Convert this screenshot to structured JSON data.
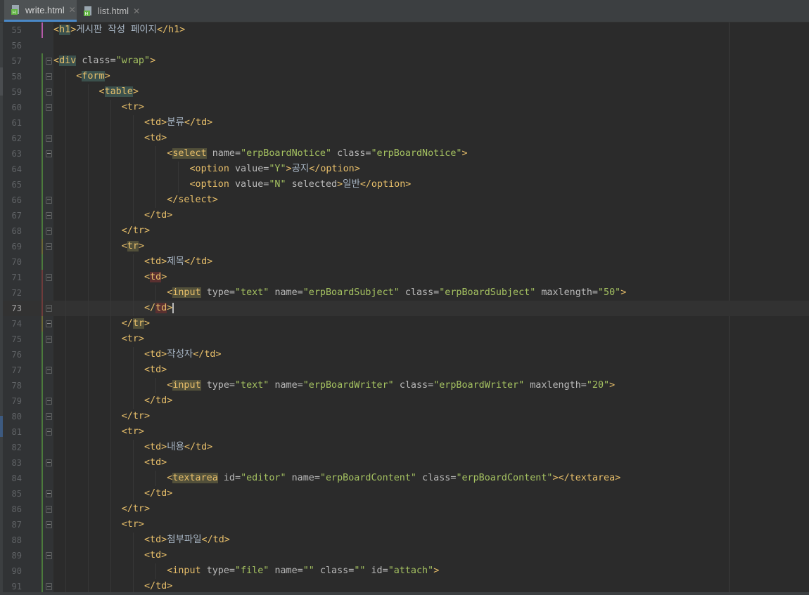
{
  "tabs": [
    {
      "label": "write.html",
      "active": true
    },
    {
      "label": "list.html",
      "active": false
    }
  ],
  "colors": {
    "tag": "#e8bf6a",
    "attribute": "#bababa",
    "value": "#a5c261",
    "text": "#a9b7c6",
    "line_number": "#606366"
  },
  "current_line": 73,
  "lines": [
    {
      "n": 55,
      "indent": 0,
      "tokens": [
        [
          "t",
          "<h1>"
        ],
        [
          "x",
          "게시판 작성 페이지"
        ],
        [
          "t",
          "</h1>"
        ]
      ]
    },
    {
      "n": 56,
      "indent": 0,
      "tokens": []
    },
    {
      "n": 57,
      "indent": 0,
      "fold": true,
      "tokens": [
        [
          "t",
          "<div "
        ],
        [
          "a",
          "class="
        ],
        [
          "v",
          "\"wrap\""
        ],
        [
          "t",
          ">"
        ]
      ]
    },
    {
      "n": 58,
      "indent": 1,
      "fold": true,
      "tokens": [
        [
          "t",
          "<form>"
        ]
      ]
    },
    {
      "n": 59,
      "indent": 2,
      "fold": true,
      "tokens": [
        [
          "t",
          "<table>"
        ]
      ]
    },
    {
      "n": 60,
      "indent": 3,
      "fold": true,
      "tokens": [
        [
          "t",
          "<tr>"
        ]
      ]
    },
    {
      "n": 61,
      "indent": 4,
      "tokens": [
        [
          "t",
          "<td>"
        ],
        [
          "x",
          "분류"
        ],
        [
          "t",
          "</td>"
        ]
      ]
    },
    {
      "n": 62,
      "indent": 4,
      "fold": true,
      "tokens": [
        [
          "t",
          "<td>"
        ]
      ]
    },
    {
      "n": 63,
      "indent": 5,
      "fold": true,
      "tokens": [
        [
          "t",
          "<select "
        ],
        [
          "a",
          "name="
        ],
        [
          "v",
          "\"erpBoardNotice\" "
        ],
        [
          "a",
          "class="
        ],
        [
          "v",
          "\"erpBoardNotice\""
        ],
        [
          "t",
          ">"
        ]
      ]
    },
    {
      "n": 64,
      "indent": 6,
      "tokens": [
        [
          "t",
          "<option "
        ],
        [
          "a",
          "value="
        ],
        [
          "v",
          "\"Y\""
        ],
        [
          "t",
          ">"
        ],
        [
          "x",
          "공지"
        ],
        [
          "t",
          "</option>"
        ]
      ]
    },
    {
      "n": 65,
      "indent": 6,
      "tokens": [
        [
          "t",
          "<option "
        ],
        [
          "a",
          "value="
        ],
        [
          "v",
          "\"N\" "
        ],
        [
          "a",
          "selected"
        ],
        [
          "t",
          ">"
        ],
        [
          "x",
          "일반"
        ],
        [
          "t",
          "</option>"
        ]
      ]
    },
    {
      "n": 66,
      "indent": 5,
      "fold": true,
      "tokens": [
        [
          "t",
          "</select>"
        ]
      ]
    },
    {
      "n": 67,
      "indent": 4,
      "fold": true,
      "tokens": [
        [
          "t",
          "</td>"
        ]
      ]
    },
    {
      "n": 68,
      "indent": 3,
      "fold": true,
      "tokens": [
        [
          "t",
          "</tr>"
        ]
      ]
    },
    {
      "n": 69,
      "indent": 3,
      "fold": true,
      "tokens": [
        [
          "t",
          "<tr>"
        ]
      ]
    },
    {
      "n": 70,
      "indent": 4,
      "tokens": [
        [
          "t",
          "<td>"
        ],
        [
          "x",
          "제목"
        ],
        [
          "t",
          "</td>"
        ]
      ]
    },
    {
      "n": 71,
      "indent": 4,
      "fold": true,
      "tokens": [
        [
          "t",
          "<td>"
        ]
      ]
    },
    {
      "n": 72,
      "indent": 5,
      "tokens": [
        [
          "t",
          "<input "
        ],
        [
          "a",
          "type="
        ],
        [
          "v",
          "\"text\" "
        ],
        [
          "a",
          "name="
        ],
        [
          "v",
          "\"erpBoardSubject\" "
        ],
        [
          "a",
          "class="
        ],
        [
          "v",
          "\"erpBoardSubject\" "
        ],
        [
          "a",
          "maxlength="
        ],
        [
          "v",
          "\"50\""
        ],
        [
          "t",
          ">"
        ]
      ]
    },
    {
      "n": 73,
      "indent": 4,
      "fold": true,
      "tokens": [
        [
          "t",
          "</td>"
        ]
      ]
    },
    {
      "n": 74,
      "indent": 3,
      "fold": true,
      "tokens": [
        [
          "t",
          "</tr>"
        ]
      ]
    },
    {
      "n": 75,
      "indent": 3,
      "fold": true,
      "tokens": [
        [
          "t",
          "<tr>"
        ]
      ]
    },
    {
      "n": 76,
      "indent": 4,
      "tokens": [
        [
          "t",
          "<td>"
        ],
        [
          "x",
          "작성자"
        ],
        [
          "t",
          "</td>"
        ]
      ]
    },
    {
      "n": 77,
      "indent": 4,
      "fold": true,
      "tokens": [
        [
          "t",
          "<td>"
        ]
      ]
    },
    {
      "n": 78,
      "indent": 5,
      "tokens": [
        [
          "t",
          "<input "
        ],
        [
          "a",
          "type="
        ],
        [
          "v",
          "\"text\" "
        ],
        [
          "a",
          "name="
        ],
        [
          "v",
          "\"erpBoardWriter\" "
        ],
        [
          "a",
          "class="
        ],
        [
          "v",
          "\"erpBoardWriter\" "
        ],
        [
          "a",
          "maxlength="
        ],
        [
          "v",
          "\"20\""
        ],
        [
          "t",
          ">"
        ]
      ]
    },
    {
      "n": 79,
      "indent": 4,
      "fold": true,
      "tokens": [
        [
          "t",
          "</td>"
        ]
      ]
    },
    {
      "n": 80,
      "indent": 3,
      "fold": true,
      "tokens": [
        [
          "t",
          "</tr>"
        ]
      ]
    },
    {
      "n": 81,
      "indent": 3,
      "fold": true,
      "tokens": [
        [
          "t",
          "<tr>"
        ]
      ]
    },
    {
      "n": 82,
      "indent": 4,
      "tokens": [
        [
          "t",
          "<td>"
        ],
        [
          "x",
          "내용"
        ],
        [
          "t",
          "</td>"
        ]
      ]
    },
    {
      "n": 83,
      "indent": 4,
      "fold": true,
      "tokens": [
        [
          "t",
          "<td>"
        ]
      ]
    },
    {
      "n": 84,
      "indent": 5,
      "tokens": [
        [
          "t",
          "<textarea "
        ],
        [
          "a",
          "id="
        ],
        [
          "v",
          "\"editor\" "
        ],
        [
          "a",
          "name="
        ],
        [
          "v",
          "\"erpBoardContent\" "
        ],
        [
          "a",
          "class="
        ],
        [
          "v",
          "\"erpBoardContent\""
        ],
        [
          "t",
          "></textarea>"
        ]
      ]
    },
    {
      "n": 85,
      "indent": 4,
      "fold": true,
      "tokens": [
        [
          "t",
          "</td>"
        ]
      ]
    },
    {
      "n": 86,
      "indent": 3,
      "fold": true,
      "tokens": [
        [
          "t",
          "</tr>"
        ]
      ]
    },
    {
      "n": 87,
      "indent": 3,
      "fold": true,
      "tokens": [
        [
          "t",
          "<tr>"
        ]
      ]
    },
    {
      "n": 88,
      "indent": 4,
      "tokens": [
        [
          "t",
          "<td>"
        ],
        [
          "x",
          "첨부파일"
        ],
        [
          "t",
          "</td>"
        ]
      ]
    },
    {
      "n": 89,
      "indent": 4,
      "fold": true,
      "tokens": [
        [
          "t",
          "<td>"
        ]
      ]
    },
    {
      "n": 90,
      "indent": 5,
      "tokens": [
        [
          "t",
          "<input "
        ],
        [
          "a",
          "type="
        ],
        [
          "v",
          "\"file\" "
        ],
        [
          "a",
          "name="
        ],
        [
          "v",
          "\"\" "
        ],
        [
          "a",
          "class="
        ],
        [
          "v",
          "\"\" "
        ],
        [
          "a",
          "id="
        ],
        [
          "v",
          "\"attach\""
        ],
        [
          "t",
          ">"
        ]
      ]
    },
    {
      "n": 91,
      "indent": 4,
      "fold": true,
      "tokens": [
        [
          "t",
          "</td>"
        ]
      ]
    }
  ]
}
